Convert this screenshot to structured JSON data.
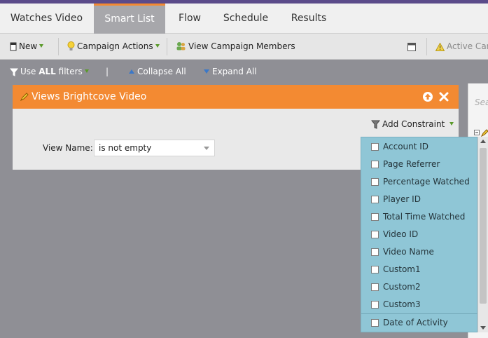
{
  "tabs": [
    {
      "label": "Watches Video",
      "active": false
    },
    {
      "label": "Smart List",
      "active": true
    },
    {
      "label": "Flow",
      "active": false
    },
    {
      "label": "Schedule",
      "active": false
    },
    {
      "label": "Results",
      "active": false
    }
  ],
  "toolbar": {
    "new_label": "New",
    "campaign_actions_label": "Campaign Actions",
    "view_members_label": "View Campaign Members",
    "active_label": "Active Cam"
  },
  "filterbar": {
    "use_prefix": "Use ",
    "use_bold": "ALL",
    "use_suffix": " filters",
    "separator": "|",
    "collapse_label": "Collapse All",
    "expand_label": "Expand All"
  },
  "filter_panel": {
    "title": "Views Brightcove Video",
    "add_constraint_label": "Add Constraint",
    "field_label": "View Name:",
    "field_value": "is not empty"
  },
  "right_panel": {
    "search_placeholder": "Sea"
  },
  "constraint_menu": {
    "items": [
      "Account ID",
      "Page Referrer",
      "Percentage Watched",
      "Player ID",
      "Total Time Watched",
      "Video ID",
      "Video Name",
      "Custom1",
      "Custom2",
      "Custom3",
      "Date of Activity"
    ]
  },
  "colors": {
    "accent": "#f38a32",
    "menu_bg": "#8fc6d6",
    "header_strip": "#5b4b8a"
  }
}
